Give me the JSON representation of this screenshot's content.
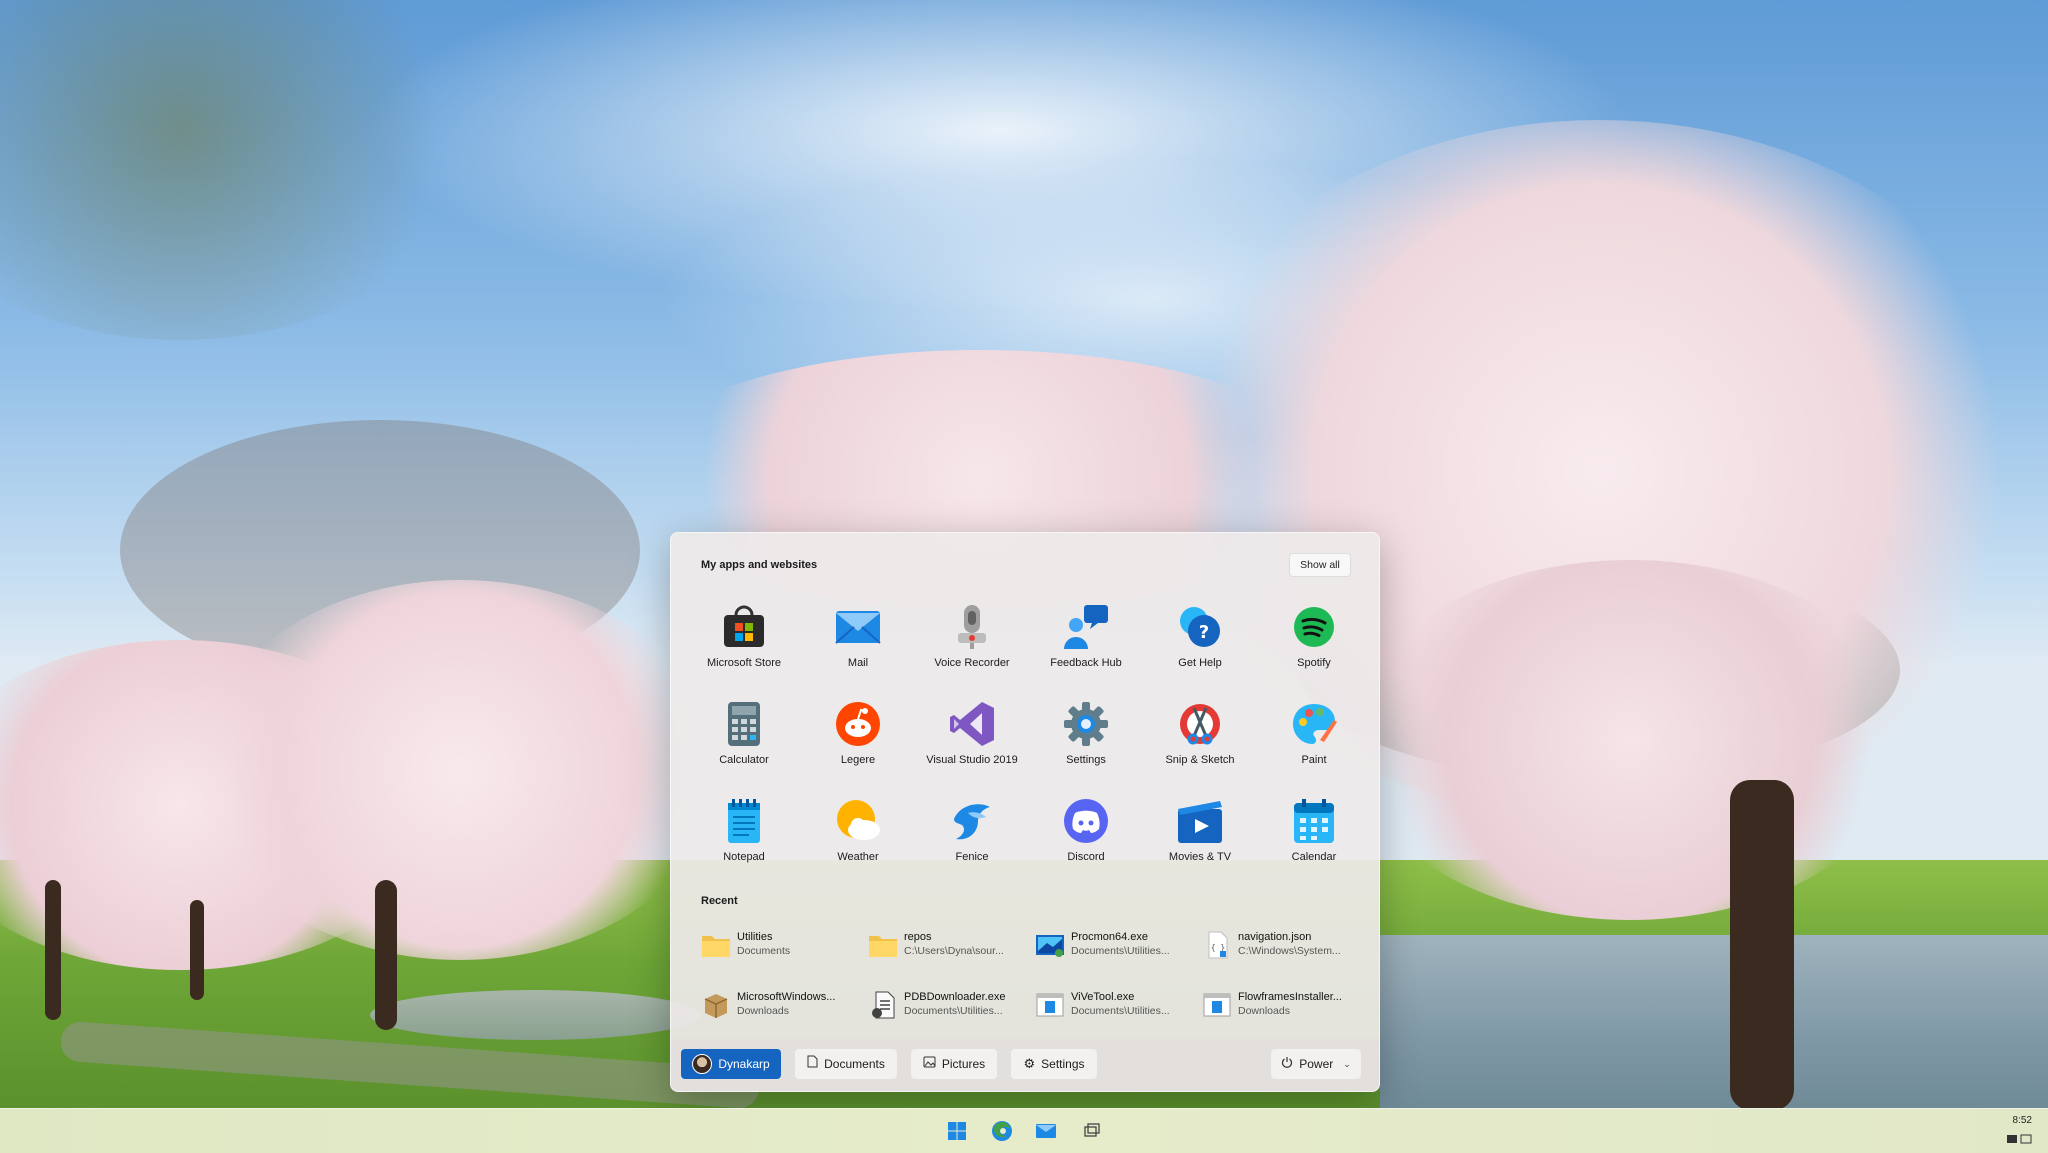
{
  "start_menu": {
    "apps_title": "My apps and websites",
    "show_all": "Show all",
    "apps": [
      {
        "label": "Microsoft Store",
        "icon": "microsoft-store-icon"
      },
      {
        "label": "Mail",
        "icon": "mail-icon"
      },
      {
        "label": "Voice Recorder",
        "icon": "voice-recorder-icon"
      },
      {
        "label": "Feedback Hub",
        "icon": "feedback-hub-icon"
      },
      {
        "label": "Get Help",
        "icon": "get-help-icon"
      },
      {
        "label": "Spotify",
        "icon": "spotify-icon"
      },
      {
        "label": "Calculator",
        "icon": "calculator-icon"
      },
      {
        "label": "Legere",
        "icon": "legere-icon"
      },
      {
        "label": "Visual Studio 2019",
        "icon": "visual-studio-icon"
      },
      {
        "label": "Settings",
        "icon": "settings-gear-icon"
      },
      {
        "label": "Snip & Sketch",
        "icon": "snip-sketch-icon"
      },
      {
        "label": "Paint",
        "icon": "paint-palette-icon"
      },
      {
        "label": "Notepad",
        "icon": "notepad-icon"
      },
      {
        "label": "Weather",
        "icon": "weather-icon"
      },
      {
        "label": "Fenice",
        "icon": "fenice-icon"
      },
      {
        "label": "Discord",
        "icon": "discord-icon"
      },
      {
        "label": "Movies & TV",
        "icon": "movies-tv-icon"
      },
      {
        "label": "Calendar",
        "icon": "calendar-icon"
      }
    ],
    "recent_title": "Recent",
    "recent": [
      {
        "name": "Utilities",
        "path": "Documents",
        "icon": "folder-icon"
      },
      {
        "name": "repos",
        "path": "C:\\Users\\Dyna\\sour...",
        "icon": "folder-icon"
      },
      {
        "name": "Procmon64.exe",
        "path": "Documents\\Utilities...",
        "icon": "procmon-icon"
      },
      {
        "name": "navigation.json",
        "path": "C:\\Windows\\System...",
        "icon": "json-file-icon"
      },
      {
        "name": "MicrosoftWindows...",
        "path": "Downloads",
        "icon": "package-icon"
      },
      {
        "name": "PDBDownloader.exe",
        "path": "Documents\\Utilities...",
        "icon": "exe-file-icon"
      },
      {
        "name": "ViVeTool.exe",
        "path": "Documents\\Utilities...",
        "icon": "exe-window-icon"
      },
      {
        "name": "FlowframesInstaller...",
        "path": "Downloads",
        "icon": "exe-window-icon"
      }
    ],
    "footer": {
      "user": "Dynakarp",
      "documents": "Documents",
      "pictures": "Pictures",
      "settings": "Settings",
      "power": "Power"
    }
  },
  "taskbar": {
    "icons": [
      "start-icon",
      "edge-icon",
      "mail-icon",
      "task-view-icon"
    ],
    "clock": "8:52"
  }
}
